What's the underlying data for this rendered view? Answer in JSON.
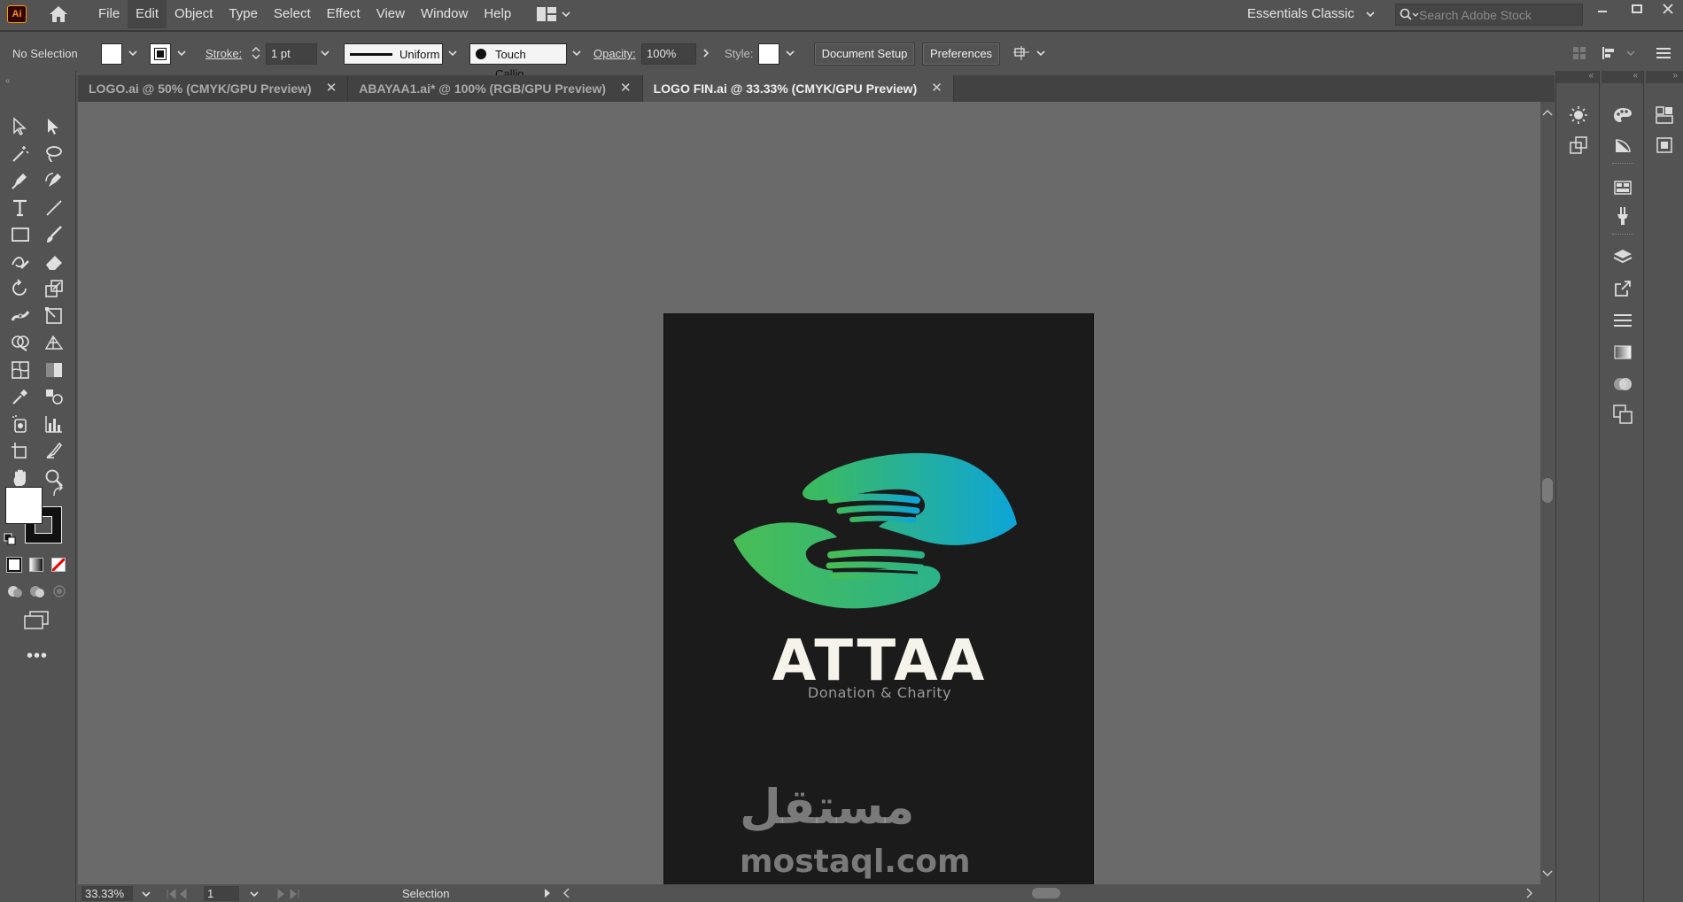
{
  "app": {
    "logo_text": "Ai"
  },
  "menu": {
    "items": [
      {
        "label": "File"
      },
      {
        "label": "Edit"
      },
      {
        "label": "Object"
      },
      {
        "label": "Type"
      },
      {
        "label": "Select"
      },
      {
        "label": "Effect"
      },
      {
        "label": "View"
      },
      {
        "label": "Window"
      },
      {
        "label": "Help"
      }
    ],
    "workspace": "Essentials Classic",
    "search_placeholder": "Search Adobe Stock"
  },
  "control": {
    "selection": "No Selection",
    "stroke_label": "Stroke:",
    "stroke_weight": "1 pt",
    "stroke_profile": "Uniform",
    "brush": "Touch Callig...",
    "opacity_label": "Opacity:",
    "opacity": "100%",
    "style_label": "Style:",
    "document_setup": "Document Setup",
    "preferences": "Preferences"
  },
  "tabs": [
    {
      "label": "LOGO.ai @ 50% (CMYK/GPU Preview)",
      "active": false
    },
    {
      "label": "ABAYAA1.ai* @ 100% (RGB/GPU Preview)",
      "active": false
    },
    {
      "label": "LOGO FIN.ai @ 33.33% (CMYK/GPU Preview)",
      "active": true
    }
  ],
  "artboard": {
    "title": "ATTAA",
    "subtitle": "Donation & Charity",
    "background": "#1b1b1b",
    "gradient_start": "#3dbb5b",
    "gradient_end": "#0ea5d8"
  },
  "watermark": {
    "arabic": "مستقل",
    "latin": "mostaql.com"
  },
  "status": {
    "zoom": "33.33%",
    "page": "1",
    "tool": "Selection"
  },
  "colors": {
    "ui_bg": "#535353",
    "canvas_bg": "#6a6a6a",
    "tab_bg": "#424242"
  }
}
